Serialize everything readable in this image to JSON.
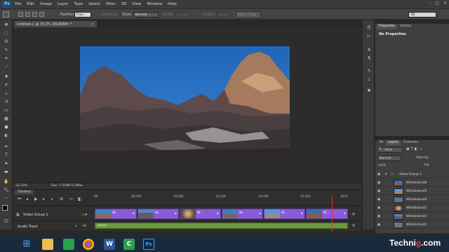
{
  "menu": {
    "logo": "Ps",
    "items": [
      "File",
      "Edit",
      "Image",
      "Layer",
      "Type",
      "Select",
      "Filter",
      "3D",
      "View",
      "Window",
      "Help"
    ]
  },
  "options": {
    "feather_label": "Feather:",
    "feather_value": "0 px",
    "antialias_label": "Anti-alias",
    "style_label": "Style:",
    "style_value": "Normal",
    "width_label": "Width:",
    "height_label": "Height:",
    "refine_button": "Refine Edge...",
    "workspace_value": "3D"
  },
  "document": {
    "tab_title": "Untitled-1 @ 33.3% (RGB/8#) *",
    "zoom": "33.33%",
    "doc_info": "Doc: 5.93M/75.4M"
  },
  "timeline": {
    "tab_label": "Timeline",
    "ruler": [
      "00",
      "05:00f",
      "10:00f",
      "15:00f",
      "20:00f",
      "25:00f",
      "30:0"
    ],
    "video_track_label": "Video Group 1",
    "audio_track_label": "Audio Track",
    "clip_label": "W...",
    "audio_clip_label": "music"
  },
  "panels": {
    "properties_tab": "Properties",
    "history_tab": "History",
    "no_properties": "No Properties",
    "layers_tab": "Layers",
    "channels_tab": "Channels",
    "three_d_tab": "3D",
    "kind_label": "Kind",
    "blend_mode": "Normal",
    "opacity_label": "Opacity:",
    "lock_label": "Lock:",
    "fill_label": "Fill:",
    "group_name": "Video Group 1",
    "layers": [
      "WhiteIsland6",
      "WhiteIsland5",
      "WhiteIsland4",
      "WhiteIsland3",
      "WhiteIsland2",
      "WhiteIsland1"
    ]
  },
  "watermark": {
    "main": "Techni",
    "accent": "g",
    "tail": ".com"
  },
  "colors": {
    "clip": "#8a5bd6",
    "audio_clip": "#6a9a3c",
    "playhead": "#e03030",
    "sky": "#2a74c4"
  }
}
